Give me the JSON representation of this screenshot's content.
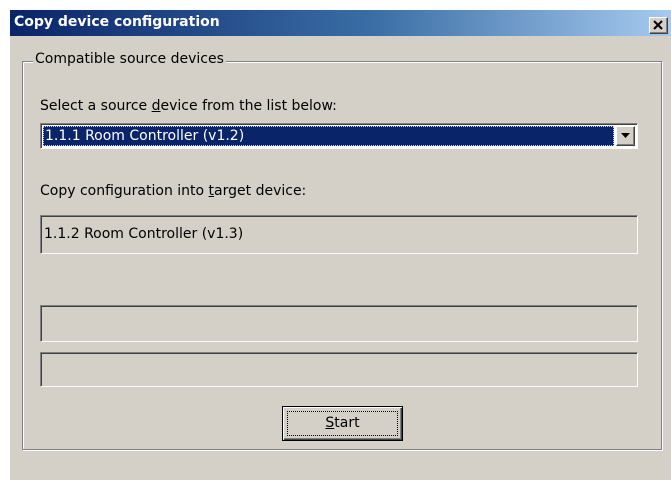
{
  "window": {
    "title": "Copy device configuration"
  },
  "group": {
    "legend": "Compatible source devices"
  },
  "source": {
    "label_pre": "Select a source ",
    "label_accel": "d",
    "label_post": "evice from the list below:",
    "selected": "1.1.1 Room Controller (v1.2)"
  },
  "target": {
    "label_pre": "Copy configuration into ",
    "label_accel": "t",
    "label_post": "arget device:",
    "value": "1.1.2 Room Controller (v1.3)"
  },
  "status": {
    "line1": "",
    "line2": ""
  },
  "start_button": {
    "accel": "S",
    "rest": "tart"
  },
  "icons": {
    "close": "close-icon",
    "dropdown": "chevron-down-icon"
  }
}
